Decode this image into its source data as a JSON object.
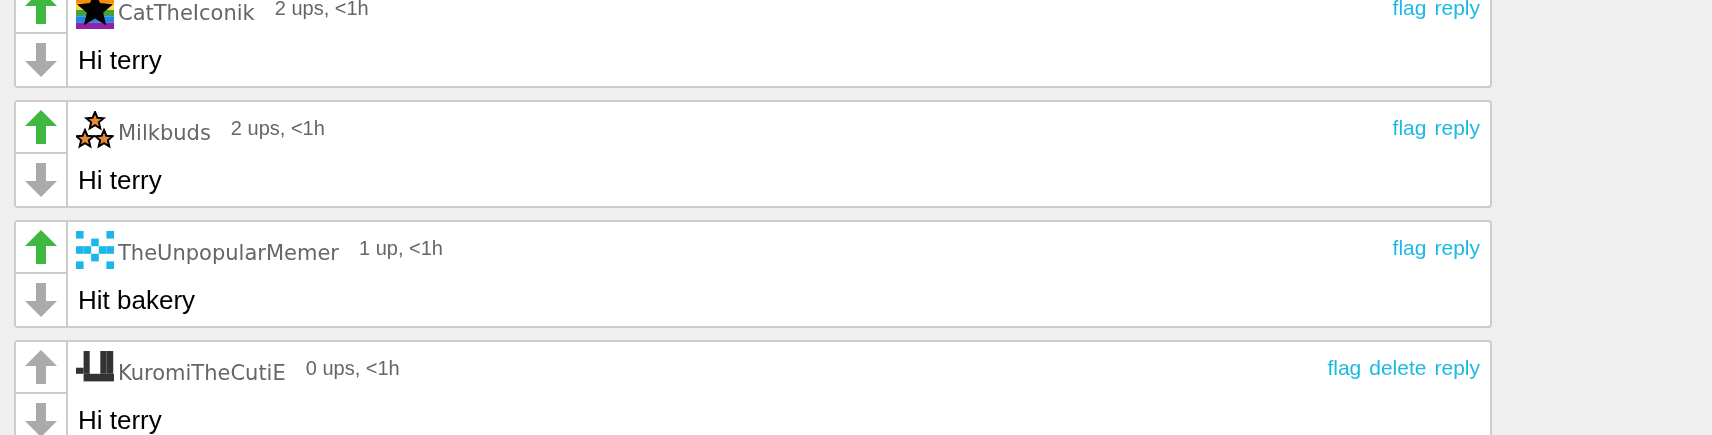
{
  "comments": [
    {
      "kind": "rainbow-star",
      "username": "CatTheIconik",
      "stats": "2 ups, <1h",
      "upvoted": true,
      "downvoted": false,
      "actions": [
        "flag",
        "reply"
      ],
      "text": "Hi terry"
    },
    {
      "kind": "stars",
      "username": "Milkbuds",
      "stats": "2 ups, <1h",
      "upvoted": true,
      "downvoted": false,
      "actions": [
        "flag",
        "reply"
      ],
      "text": "Hi terry"
    },
    {
      "kind": "pixels",
      "username": "TheUnpopularMemer",
      "stats": "1 up, <1h",
      "upvoted": true,
      "downvoted": false,
      "actions": [
        "flag",
        "reply"
      ],
      "text": "Hit bakery"
    },
    {
      "kind": "face",
      "username": "KuromiTheCutiE",
      "stats": "0 ups, <1h",
      "upvoted": false,
      "downvoted": false,
      "actions": [
        "flag",
        "delete",
        "reply"
      ],
      "text": "Hi terry"
    }
  ]
}
